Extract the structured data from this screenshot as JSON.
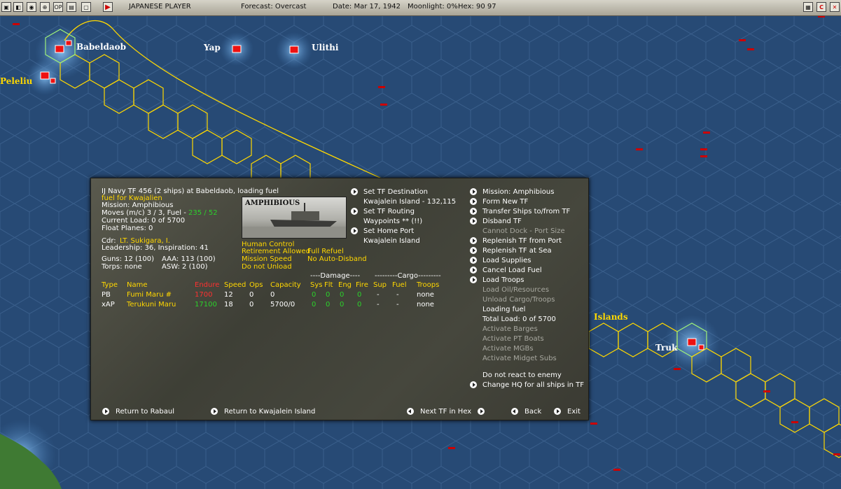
{
  "toolbar": {
    "icons": [
      "save-icon",
      "toggle-icon",
      "globe-icon",
      "target-icon",
      "op-icon",
      "report-icon",
      "window-icon",
      "play-icon"
    ],
    "op_label": "OP",
    "player": "JAPANESE PLAYER",
    "forecast": "Forecast: Overcast",
    "date": "Date: Mar 17, 1942",
    "moonlight": "Moonlight: 0%",
    "hex": "Hex: 90 97",
    "right_icons": [
      "map-icon",
      "c-icon",
      "close-icon"
    ],
    "c_label": "C"
  },
  "map": {
    "labels": {
      "babeldaob": "Babeldaob",
      "yap": "Yap",
      "ulithi": "Ulithi",
      "peleliu": "Peleliu",
      "islands": "Islands",
      "truk": "Truk"
    },
    "colors": {
      "ocean": "#274a75",
      "route": "#ffd800",
      "shallow": "#6fa6dc",
      "land": "#3f7a33"
    }
  },
  "tf": {
    "header": "IJ Navy TF 456 (2 ships) at Babeldaob, loading fuel",
    "fuel_note": "fuel for Kwajalien",
    "mission": "Mission: Amphibious",
    "moves_prefix": "Moves (m/c) 3 / 3, Fuel - ",
    "moves_fuel": "235 / 52",
    "current_load": "Current Load:  0 of 5700",
    "float_planes": "Float Planes: 0",
    "cdr_prefix": "Cdr:",
    "cdr_name": "LT. Sukigara, I.",
    "leadership": "Leadership: 36, Inspiration: 41",
    "guns": "Guns: 12 (100)",
    "aaa": "AAA: 113 (100)",
    "torps": "Torps: none",
    "asw": "ASW: 2 (100)",
    "photo_title": "AMPHIBIOUS",
    "orders": {
      "human_control": "Human Control",
      "retirement": "Retirement Allowed",
      "full_refuel": "Full Refuel",
      "mission_speed": "Mission Speed",
      "no_auto_disband": "No Auto-Disband",
      "do_not_unload": "Do not Unload"
    }
  },
  "routing": {
    "set_dest": "Set TF Destination",
    "dest_value": "Kwajalein Island - 132,115",
    "set_routing": "Set TF Routing",
    "waypoints": "Waypoints ** (!!)",
    "set_home": "Set Home Port",
    "home_value": "Kwajalein Island"
  },
  "table": {
    "group_damage": "----Damage----",
    "group_cargo": "---------Cargo---------",
    "headers": {
      "type": "Type",
      "name": "Name",
      "endure": "Endure",
      "speed": "Speed",
      "ops": "Ops",
      "capacity": "Capacity",
      "sys": "Sys",
      "flt": "Flt",
      "eng": "Eng",
      "fire": "Fire",
      "sup": "Sup",
      "fuel": "Fuel",
      "troops": "Troops"
    },
    "rows": [
      {
        "type": "PB",
        "name": "Fumi Maru #",
        "endure": "1700",
        "speed": "12",
        "ops": "0",
        "capacity": "0",
        "sys": "0",
        "flt": "0",
        "eng": "0",
        "fire": "0",
        "sup": "-",
        "fuel": "-",
        "troops": "none"
      },
      {
        "type": "xAP",
        "name": "Terukuni Maru",
        "endure": "17100",
        "speed": "18",
        "ops": "0",
        "capacity": "5700/0",
        "sys": "0",
        "flt": "0",
        "eng": "0",
        "fire": "0",
        "sup": "-",
        "fuel": "-",
        "troops": "none"
      }
    ]
  },
  "actions": {
    "mission": "Mission: Amphibious",
    "form_new": "Form New TF",
    "transfer": "Transfer Ships to/from TF",
    "disband": "Disband TF",
    "cannot_dock": "Cannot Dock - Port Size",
    "replenish_port": "Replenish TF from Port",
    "replenish_sea": "Replenish TF at Sea",
    "load_supplies": "Load Supplies",
    "cancel_fuel": "Cancel Load Fuel",
    "load_troops": "Load Troops",
    "load_oil": "Load Oil/Resources",
    "unload_cargo": "Unload Cargo/Troops",
    "loading_fuel": "Loading fuel",
    "total_load": "Total Load: 0 of 5700",
    "barges": "Activate Barges",
    "pt_boats": "Activate PT Boats",
    "mgbs": "Activate MGBs",
    "midget_subs": "Activate Midget Subs",
    "no_react": "Do not react to enemy",
    "change_hq": "Change HQ for all ships in TF"
  },
  "bottom": {
    "return_rabaul": "Return to Rabaul",
    "return_kwaj": "Return to Kwajalein Island",
    "next_tf": "Next TF in Hex",
    "back": "Back",
    "exit": "Exit"
  }
}
